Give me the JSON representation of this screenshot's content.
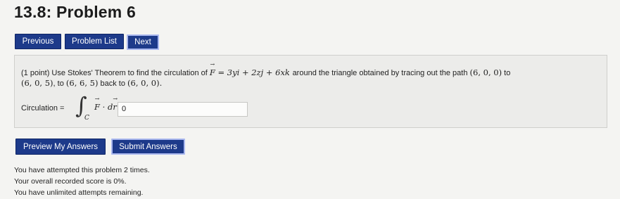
{
  "page": {
    "title": "13.8: Problem 6"
  },
  "nav": {
    "previous": "Previous",
    "problem_list": "Problem List",
    "next": "Next"
  },
  "problem": {
    "intro": "(1 point) Use Stokes' Theorem to find the circulation of",
    "field_name": "F",
    "field_eq": "= 3yi + 2zj + 6xk",
    "middle": "around the triangle obtained by tracing out the path",
    "p1": "(6, 0, 0)",
    "to1": "to",
    "p2": "(6, 0, 5)",
    "to2": ", to",
    "p3": "(6, 6, 5)",
    "back": "back to",
    "p4": "(6, 0, 0).",
    "circulation_label": "Circulation =",
    "integral_sub": "C",
    "integrand": "F · dr =",
    "answer_value": "0"
  },
  "actions": {
    "preview": "Preview My Answers",
    "submit": "Submit Answers"
  },
  "status": {
    "attempts": "You have attempted this problem 2 times.",
    "score": "Your overall recorded score is 0%.",
    "remaining": "You have unlimited attempts remaining."
  },
  "colors": {
    "button": "#1d3a8a",
    "background": "#f4f4f2",
    "panel": "#ececea"
  }
}
